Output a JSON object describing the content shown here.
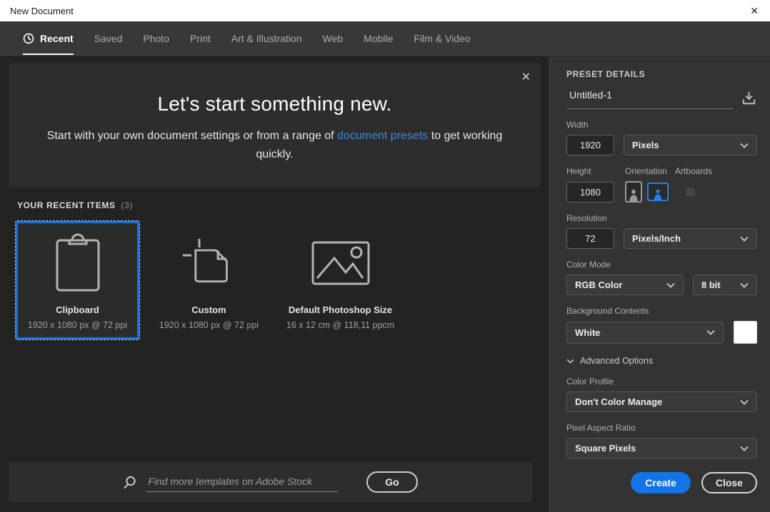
{
  "window": {
    "title": "New Document",
    "close_icon": "✕"
  },
  "tabs": {
    "items": [
      {
        "label": "Recent",
        "active": true
      },
      {
        "label": "Saved"
      },
      {
        "label": "Photo"
      },
      {
        "label": "Print"
      },
      {
        "label": "Art & Illustration"
      },
      {
        "label": "Web"
      },
      {
        "label": "Mobile"
      },
      {
        "label": "Film & Video"
      }
    ]
  },
  "hero": {
    "title": "Let's start something new.",
    "subtitle_pre": "Start with your own document settings or from a range of ",
    "subtitle_link": "document presets",
    "subtitle_post": " to get working quickly.",
    "close_icon": "✕"
  },
  "recent": {
    "heading": "YOUR RECENT ITEMS",
    "count": "(3)",
    "items": [
      {
        "name": "Clipboard",
        "dims": "1920 x 1080 px @ 72 ppi",
        "icon": "clipboard-icon",
        "selected": true
      },
      {
        "name": "Custom",
        "dims": "1920 x 1080 px @ 72 ppi",
        "icon": "custom-document-icon",
        "selected": false
      },
      {
        "name": "Default Photoshop Size",
        "dims": "16 x 12 cm @ 118,11 ppcm",
        "icon": "image-icon",
        "selected": false
      }
    ]
  },
  "search": {
    "placeholder": "Find more templates on Adobe Stock",
    "go_label": "Go"
  },
  "preset": {
    "heading": "PRESET DETAILS",
    "name_value": "Untitled-1",
    "width_label": "Width",
    "width_value": "1920",
    "width_unit": "Pixels",
    "height_label": "Height",
    "height_value": "1080",
    "orientation_label": "Orientation",
    "artboards_label": "Artboards",
    "resolution_label": "Resolution",
    "resolution_value": "72",
    "resolution_unit": "Pixels/Inch",
    "color_mode_label": "Color Mode",
    "color_mode_value": "RGB Color",
    "bit_depth_value": "8 bit",
    "background_label": "Background Contents",
    "background_value": "White",
    "background_swatch_color": "#ffffff",
    "advanced_label": "Advanced Options",
    "color_profile_label": "Color Profile",
    "color_profile_value": "Don't Color Manage",
    "pixel_aspect_label": "Pixel Aspect Ratio",
    "pixel_aspect_value": "Square Pixels",
    "create_label": "Create",
    "close_label": "Close"
  },
  "colors": {
    "accent_blue": "#1473e6",
    "link_blue": "#3f87d9",
    "orientation_selected_blue": "#2680eb",
    "titlebar_bg": "#ffffff",
    "tabbar_bg": "#383838",
    "main_bg": "#232323",
    "hero_bg": "#2d2d2d",
    "panel_bg": "#333333"
  }
}
